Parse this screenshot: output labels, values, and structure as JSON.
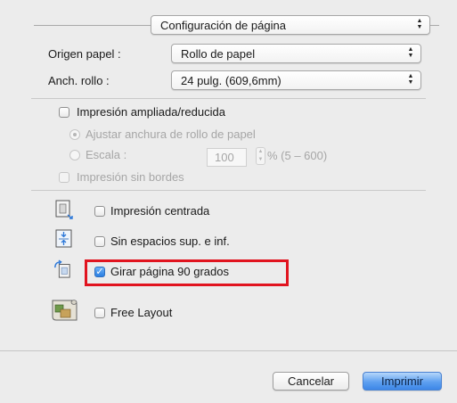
{
  "panel": {
    "selected": "Configuración de página"
  },
  "paper_source": {
    "label": "Origen papel :",
    "value": "Rollo de papel"
  },
  "roll_width": {
    "label": "Anch. rollo :",
    "value": "24 pulg. (609,6mm)"
  },
  "enlarged_reduced": {
    "label": "Impresión ampliada/reducida",
    "checked": false,
    "fit_roll_width": {
      "label": "Ajustar anchura de rollo de papel",
      "selected": true
    },
    "scale": {
      "label": "Escala :",
      "value": "100",
      "range_label": "% (5 – 600)",
      "selected": false
    }
  },
  "borderless": {
    "label": "Impresión sin bordes",
    "checked": false
  },
  "options": [
    {
      "label": "Impresión centrada",
      "checked": false,
      "icon": "centered-print-icon"
    },
    {
      "label": "Sin espacios sup. e inf.",
      "checked": false,
      "icon": "no-margins-icon"
    },
    {
      "label": "Girar página 90 grados",
      "checked": true,
      "icon": "rotate-page-icon"
    },
    {
      "label": "Free Layout",
      "checked": false,
      "icon": "free-layout-icon"
    }
  ],
  "buttons": {
    "cancel": "Cancelar",
    "print": "Imprimir"
  },
  "colors": {
    "highlight": "#e1141f",
    "accent": "#3d86e7"
  }
}
